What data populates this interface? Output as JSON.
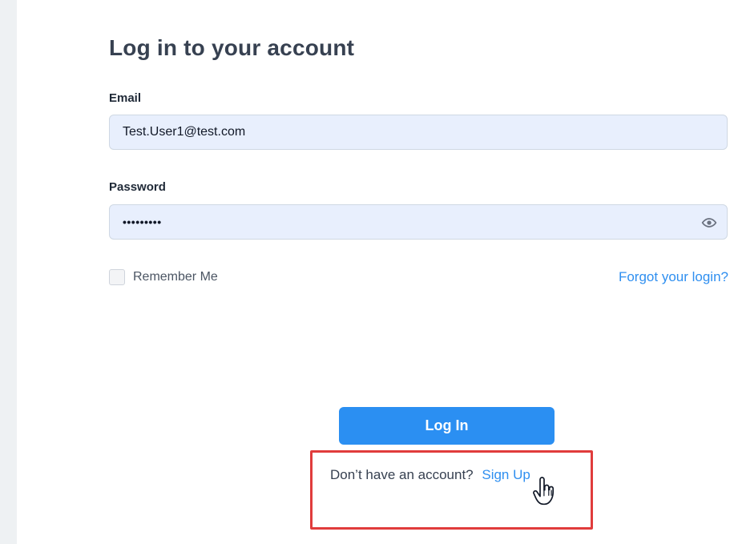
{
  "login": {
    "title": "Log in to your account",
    "email": {
      "label": "Email",
      "value": "Test.User1@test.com"
    },
    "password": {
      "label": "Password",
      "masked_value": "•••••••••",
      "toggle_icon": "eye-icon"
    },
    "remember_me": {
      "label": "Remember Me",
      "checked": false
    },
    "forgot_link": "Forgot your login?",
    "submit_label": "Log In",
    "signup_prompt": "Don’t have an account?",
    "signup_link": "Sign Up"
  },
  "colors": {
    "accent": "#2b8ff2",
    "link": "#2f8ff0",
    "highlight": "#e03c3c"
  }
}
